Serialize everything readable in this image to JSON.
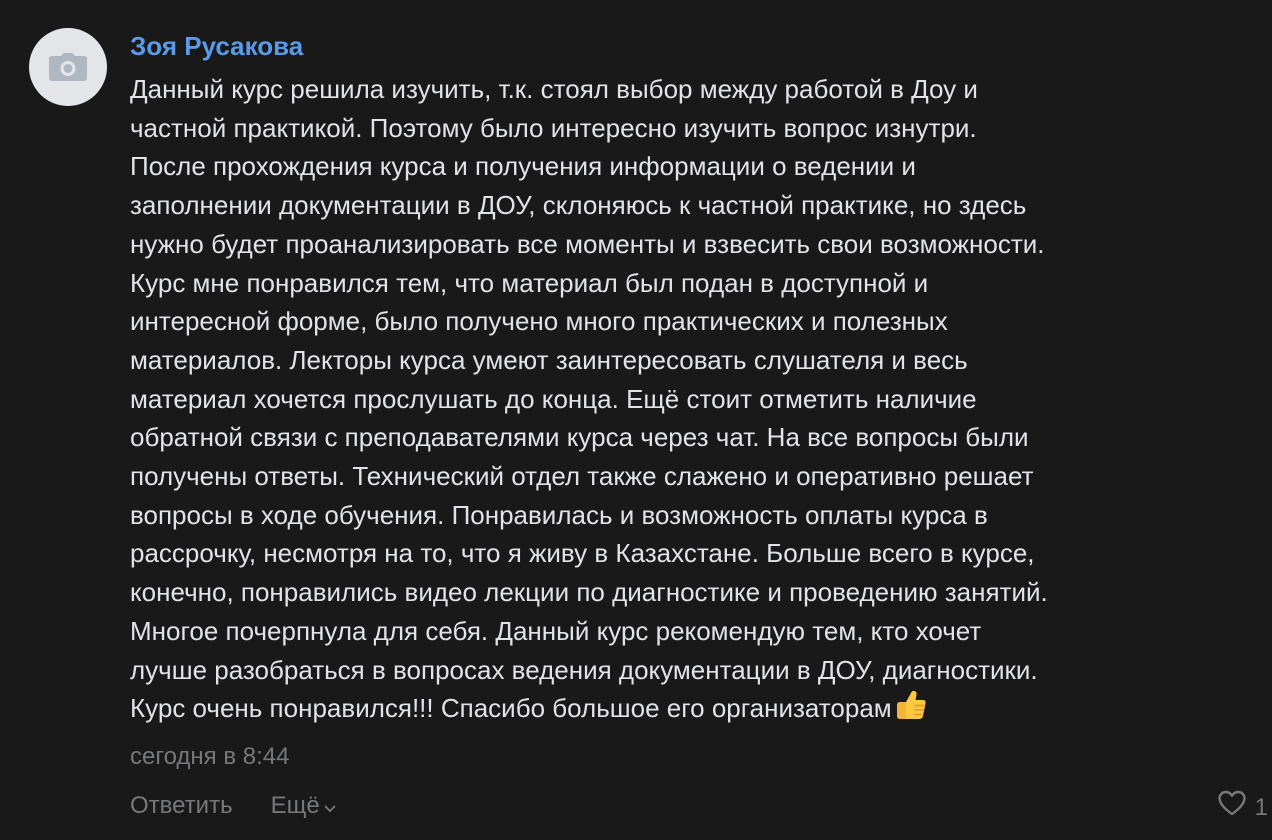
{
  "comment": {
    "author": "Зоя Русакова",
    "avatar_icon": "camera-icon",
    "text_lines": [
      "Данный курс решила изучить, т.к. стоял выбор между работой в Доу и",
      "частной практикой. Поэтому было интересно изучить вопрос изнутри.",
      "После прохождения курса и получения информации о ведении и",
      "заполнении документации в ДОУ, склоняюсь к частной практике, но здесь",
      "нужно будет проанализировать все моменты и взвесить свои возможности.",
      "Курс мне понравился тем, что материал был подан в доступной и",
      "интересной форме, было получено много практических и полезных",
      "материалов. Лекторы курса умеют заинтересовать слушателя и весь",
      "материал хочется прослушать до конца. Ещё стоит отметить наличие",
      "обратной связи с преподавателями курса через чат. На все вопросы были",
      "получены ответы. Технический отдел также слажено и оперативно решает",
      "вопросы в ходе обучения. Понравилась и возможность оплаты курса в",
      "рассрочку, несмотря на то, что я живу в Казахстане. Больше всего в курсе,",
      "конечно, понравились видео лекции по диагностике и проведению занятий.",
      "Многое почерпнула для себя. Данный курс рекомендую тем, кто хочет",
      "лучше разобраться в вопросах ведения документации в ДОУ, диагностики.",
      "Курс очень понравился!!! Спасибо большое его организаторам"
    ],
    "emoji_icon": "thumbs-up-icon",
    "timestamp": "сегодня в 8:44",
    "actions": {
      "reply_label": "Ответить",
      "more_label": "Ещё"
    },
    "likes": {
      "icon": "heart-icon",
      "count": "1"
    },
    "colors": {
      "background": "#19191a",
      "author": "#5b9ae8",
      "text": "#e1e3e6",
      "secondary": "#76787a"
    }
  }
}
